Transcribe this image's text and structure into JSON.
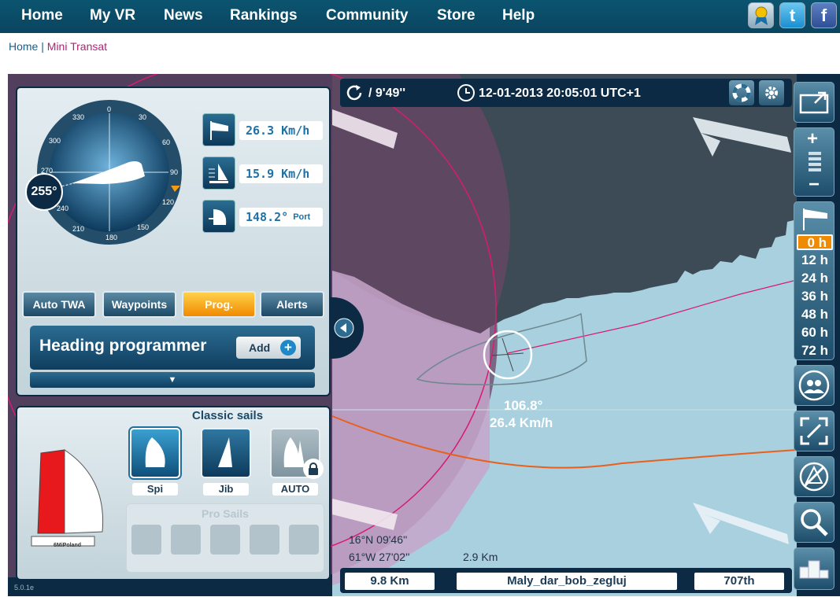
{
  "nav": {
    "items": [
      "Home",
      "My VR",
      "News",
      "Rankings",
      "Community",
      "Store",
      "Help"
    ],
    "social": [
      "award-icon",
      "twitter-icon",
      "facebook-icon"
    ]
  },
  "breadcrumb": {
    "home": "Home",
    "sep": "|",
    "current": "Mini Transat"
  },
  "compass": {
    "ticks": [
      "0",
      "30",
      "60",
      "90",
      "120",
      "150",
      "180",
      "210",
      "240",
      "270",
      "300",
      "330"
    ],
    "heading": "255°"
  },
  "instruments": {
    "wind_speed": "26.3 Km/h",
    "boat_speed": "15.9 Km/h",
    "wind_angle": "148.2°",
    "tack": "Port"
  },
  "tabs": [
    "Auto TWA",
    "Waypoints",
    "Prog.",
    "Alerts"
  ],
  "active_tab": "Prog.",
  "heading_programmer": {
    "title": "Heading programmer",
    "add_label": "Add",
    "drawer_glyph": "▼"
  },
  "sails": {
    "title": "Classic sails",
    "items": [
      "Spi",
      "Jib",
      "AUTO"
    ],
    "selected": "Spi",
    "pro_title": "Pro Sails",
    "boat_mark": "6MiPoland"
  },
  "version": "5.0.1e",
  "topbar": {
    "refresh": "/ 9'49''",
    "datetime": "12-01-2013 20:05:01 UTC+1"
  },
  "map": {
    "boat_heading": "106.8°",
    "boat_speed": "26.4 Km/h",
    "lat": "16°N 09'46''",
    "lon": "61°W 27'02''",
    "scale": "2.9 Km"
  },
  "bottombar": {
    "distance": "9.8 Km",
    "player": "Maly_dar_bob_zegluj",
    "rank": "707th"
  },
  "forecast": {
    "hours": [
      "0 h",
      "12 h",
      "24 h",
      "36 h",
      "48 h",
      "60 h",
      "72 h"
    ],
    "selected": "0 h"
  },
  "colors": {
    "sea": "#a8d0de",
    "land": "#3c4b55",
    "zone": "#6a4566",
    "accent": "#f08a00",
    "nav": "#0b5470"
  }
}
